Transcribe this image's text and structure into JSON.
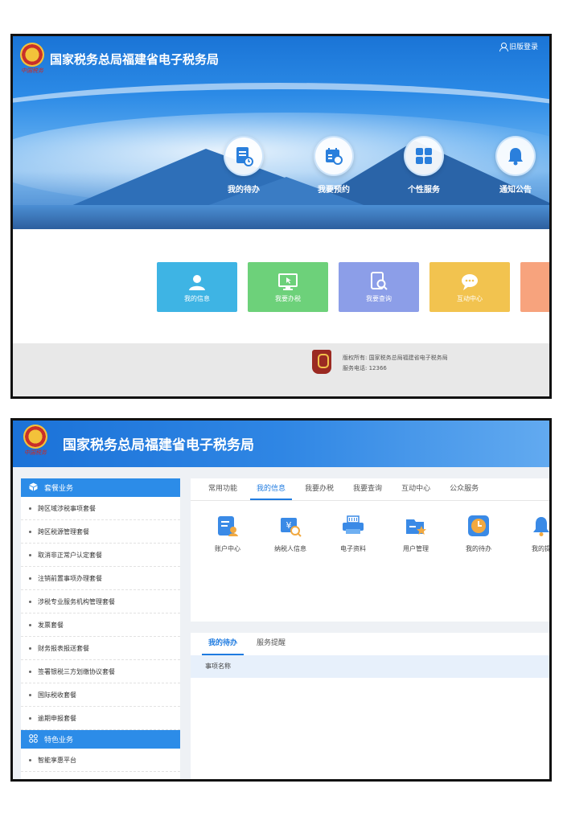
{
  "screen1": {
    "title": "国家税务总局福建省电子税务局",
    "emblem_text": "中国税务",
    "login_link": "旧版登录",
    "quick_items": [
      {
        "label": "我的待办",
        "icon": "document-clock-icon"
      },
      {
        "label": "我要预约",
        "icon": "calendar-clock-icon"
      },
      {
        "label": "个性服务",
        "icon": "grid-icon"
      },
      {
        "label": "通知公告",
        "icon": "bell-icon"
      }
    ],
    "tiles": [
      {
        "label": "我的信息",
        "color": "#3eb4e4",
        "icon": "person-icon"
      },
      {
        "label": "我要办税",
        "color": "#6dd17a",
        "icon": "monitor-cursor-icon"
      },
      {
        "label": "我要查询",
        "color": "#8c9ee8",
        "icon": "search-doc-icon"
      },
      {
        "label": "互动中心",
        "color": "#f2c34f",
        "icon": "chat-icon"
      },
      {
        "label": "",
        "color": "#f7a37d",
        "icon": ""
      }
    ],
    "footer": {
      "copyright": "版权所有: 国家税务总局福建省电子税务局",
      "phone": "服务电话: 12366"
    }
  },
  "screen2": {
    "title": "国家税务总局福建省电子税务局",
    "emblem_text": "中国税务",
    "sidebar": {
      "section1": "套餐业务",
      "items1": [
        "跨区域涉税事项套餐",
        "跨区税源管理套餐",
        "取消非正常户认定套餐",
        "注销前置事项办理套餐",
        "涉税专业服务机构管理套餐",
        "发票套餐",
        "财务报表报送套餐",
        "签署银税三方划缴协议套餐",
        "国际税收套餐",
        "逾期申报套餐"
      ],
      "section2": "特色业务",
      "items2": [
        "智能享惠平台"
      ]
    },
    "tabs": [
      "常用功能",
      "我的信息",
      "我要办税",
      "我要查询",
      "互动中心",
      "公众服务"
    ],
    "active_tab": "我的信息",
    "apps": [
      {
        "label": "账户中心",
        "icon": "account-icon"
      },
      {
        "label": "纳税人信息",
        "icon": "taxpayer-icon"
      },
      {
        "label": "电子资料",
        "icon": "printer-icon"
      },
      {
        "label": "用户管理",
        "icon": "user-manage-icon"
      },
      {
        "label": "我的待办",
        "icon": "clock-icon"
      },
      {
        "label": "我的提",
        "icon": "bell-icon"
      }
    ],
    "bottom_tabs": [
      "我的待办",
      "服务提醒"
    ],
    "column_header": "事项名称"
  }
}
